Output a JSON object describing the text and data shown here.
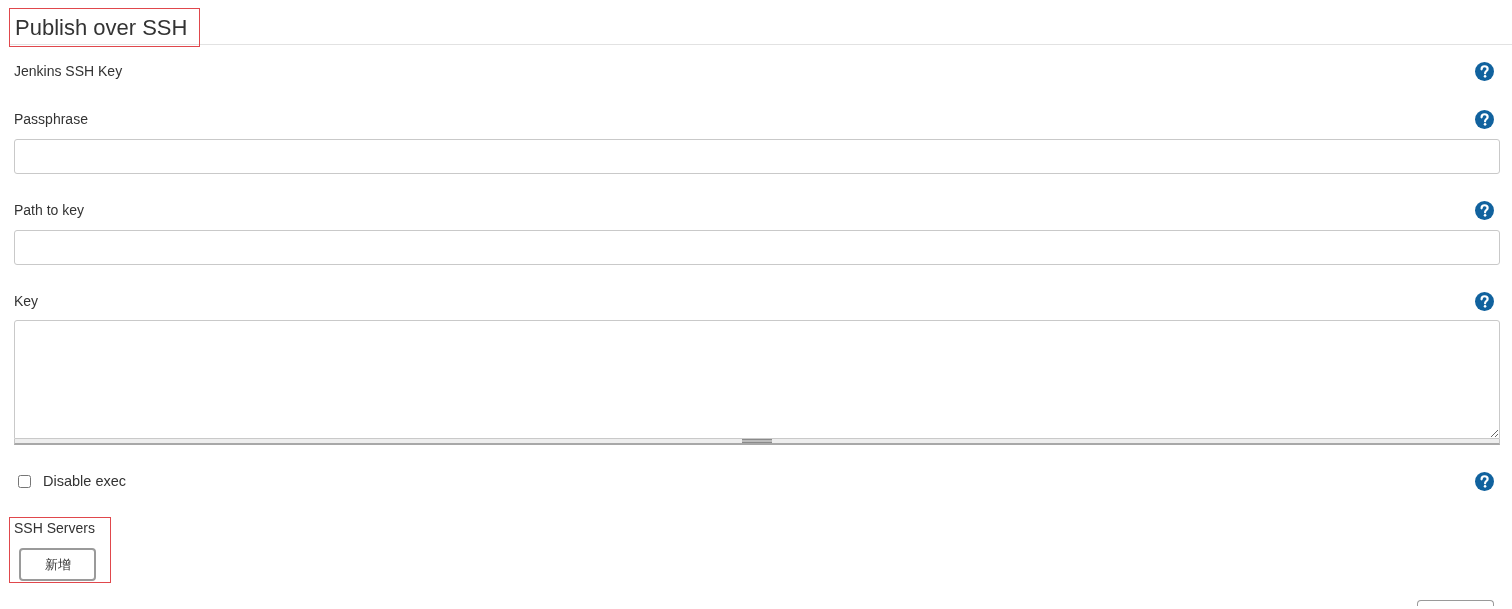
{
  "section": {
    "title": "Publish over SSH",
    "highlighted": true
  },
  "fields": [
    {
      "kind": "label",
      "label": "Jenkins SSH Key"
    },
    {
      "kind": "text",
      "label": "Passphrase"
    },
    {
      "kind": "text",
      "label": "Path to key"
    },
    {
      "kind": "textarea",
      "label": "Key"
    },
    {
      "kind": "checkbox",
      "label": "Disable exec",
      "checked": false
    }
  ],
  "ssh_servers": {
    "label": "SSH Servers",
    "highlighted": true,
    "button": "新增"
  }
}
